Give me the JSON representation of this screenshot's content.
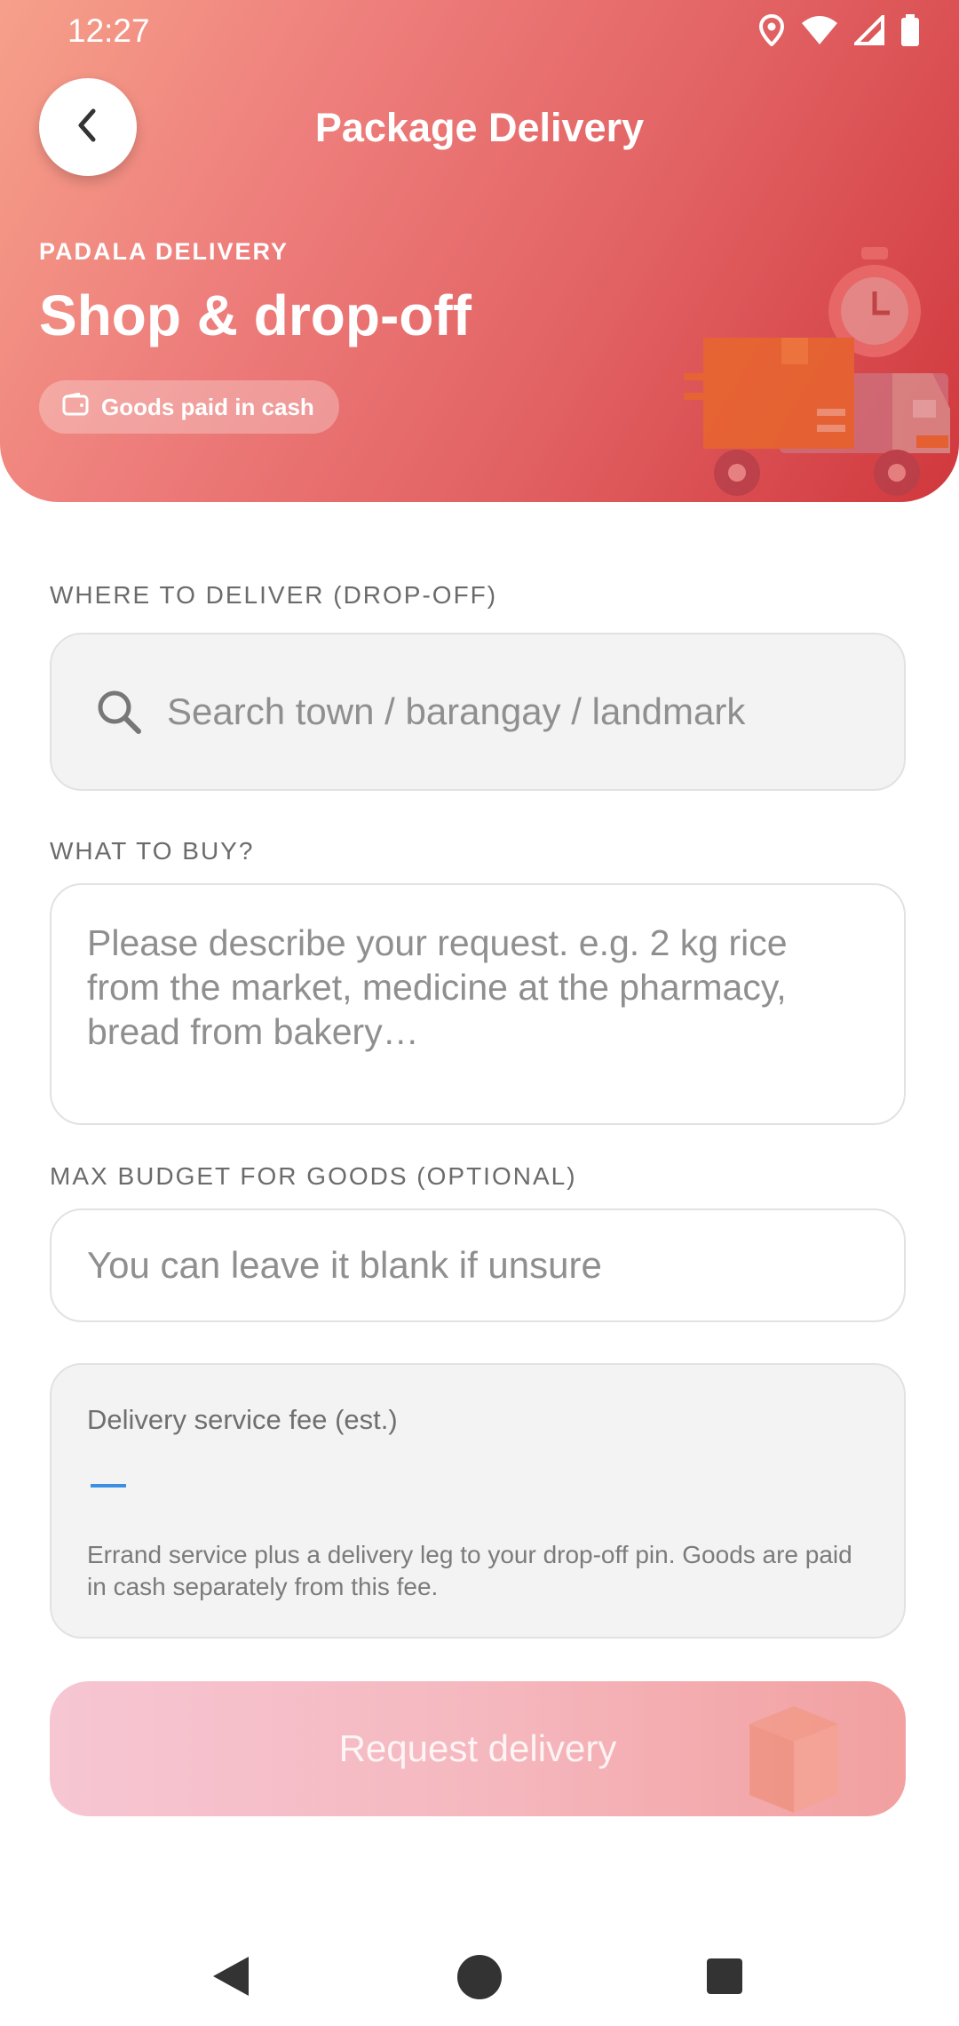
{
  "status": {
    "time": "12:27"
  },
  "header": {
    "title": "Package Delivery",
    "eyebrow": "PADALA DELIVERY",
    "hero_title": "Shop & drop-off",
    "pill_label": "Goods paid in cash"
  },
  "form": {
    "dropoff_label": "WHERE TO DELIVER (DROP-OFF)",
    "dropoff_placeholder": "Search town / barangay / landmark",
    "buy_label": "WHAT TO BUY?",
    "buy_placeholder": "Please describe your request. e.g. 2 kg rice from the market, medicine at the pharmacy, bread from bakery…",
    "budget_label": "MAX BUDGET FOR GOODS (OPTIONAL)",
    "budget_placeholder": "You can leave it blank if unsure"
  },
  "fee": {
    "title": "Delivery service fee (est.)",
    "value": "—",
    "note": "Errand service plus a delivery leg to your drop-off pin. Goods are paid in cash separately from this fee."
  },
  "actions": {
    "request_label": "Request delivery"
  },
  "colors": {
    "accent": "#d0383d",
    "fee_dash": "#3b8fe3",
    "button_start": "#f6c6d3",
    "button_end": "#f2a0a0"
  },
  "icons": [
    "location-icon",
    "wifi-icon",
    "signal-icon",
    "battery-icon",
    "back-chevron-icon",
    "wallet-icon",
    "delivery-truck-icon",
    "search-icon",
    "package-icon",
    "nav-back-icon",
    "nav-home-icon",
    "nav-recents-icon"
  ]
}
